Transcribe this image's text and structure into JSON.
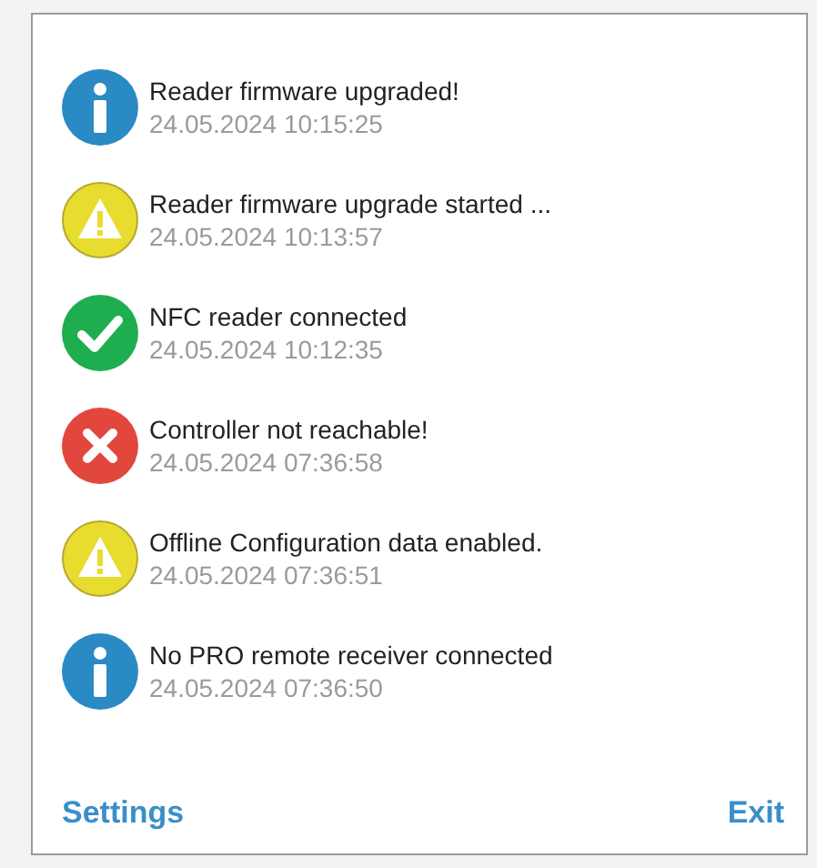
{
  "notifications": [
    {
      "kind": "info",
      "message": "Reader firmware upgraded!",
      "time": "24.05.2024 10:15:25"
    },
    {
      "kind": "warning",
      "message": "Reader firmware upgrade started ...",
      "time": "24.05.2024 10:13:57"
    },
    {
      "kind": "success",
      "message": "NFC reader connected",
      "time": "24.05.2024 10:12:35"
    },
    {
      "kind": "error",
      "message": "Controller not reachable!",
      "time": "24.05.2024 07:36:58"
    },
    {
      "kind": "warning",
      "message": "Offline Configuration data enabled.",
      "time": "24.05.2024 07:36:51"
    },
    {
      "kind": "info",
      "message": "No PRO remote receiver connected",
      "time": "24.05.2024 07:36:50"
    }
  ],
  "footer": {
    "settings": "Settings",
    "exit": "Exit"
  }
}
